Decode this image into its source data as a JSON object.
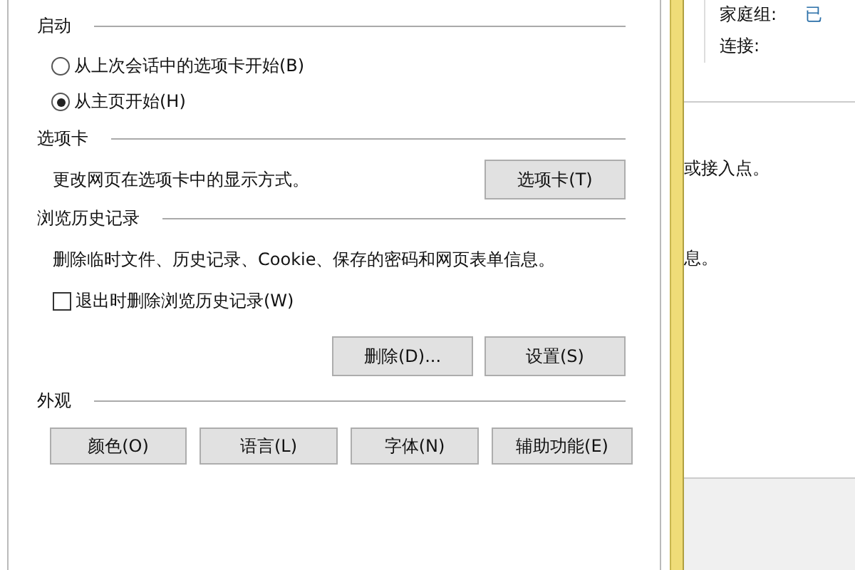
{
  "startup": {
    "title": "启动",
    "options": [
      {
        "label": "从上次会话中的选项卡开始(B)",
        "selected": false
      },
      {
        "label": "从主页开始(H)",
        "selected": true
      }
    ]
  },
  "tabs_section": {
    "title": "选项卡",
    "description": "更改网页在选项卡中的显示方式。",
    "button": "选项卡(T)"
  },
  "history": {
    "title": "浏览历史记录",
    "description": "删除临时文件、历史记录、Cookie、保存的密码和网页表单信息。",
    "checkbox": {
      "label": "退出时删除浏览历史记录(W)",
      "checked": false
    },
    "buttons": [
      "删除(D)...",
      "设置(S)"
    ]
  },
  "appearance": {
    "title": "外观",
    "buttons": [
      "颜色(O)",
      "语言(L)",
      "字体(N)",
      "辅助功能(E)"
    ]
  },
  "background_window": {
    "fields": [
      {
        "label": "家庭组:",
        "value": "已"
      },
      {
        "label": "连接:"
      }
    ],
    "texts": [
      "或接入点。",
      "息。"
    ]
  }
}
